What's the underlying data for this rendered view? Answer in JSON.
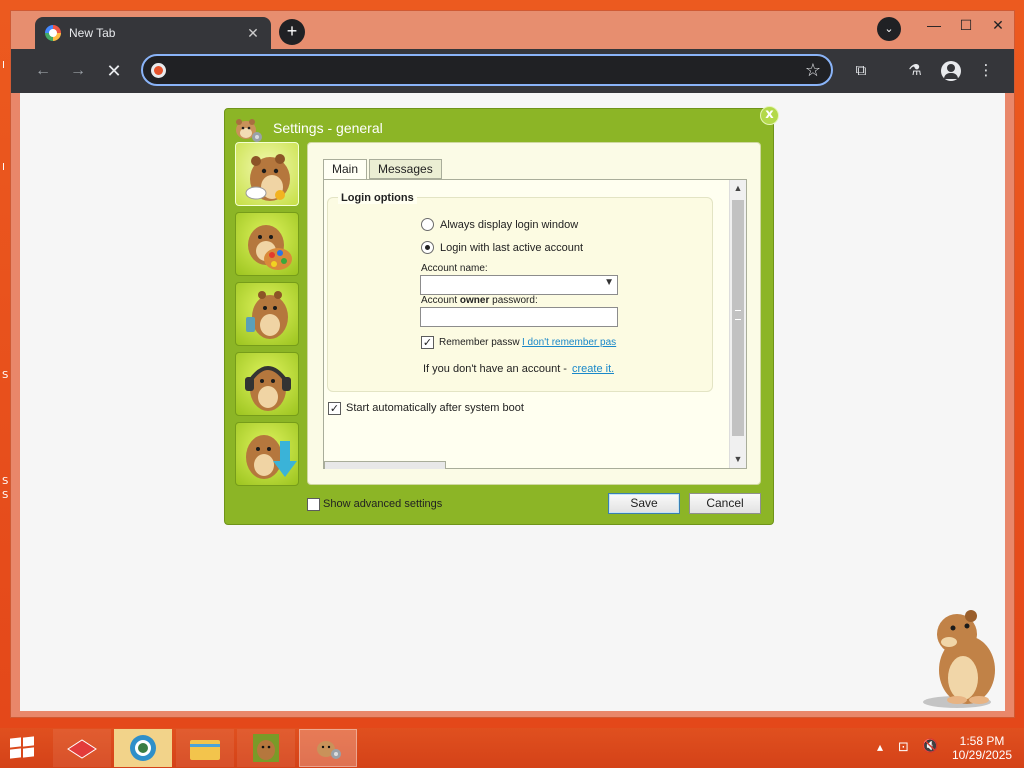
{
  "browser": {
    "tab": {
      "title": "New Tab",
      "close_glyph": "✕"
    },
    "new_tab_glyph": "+",
    "tab_search_glyph": "⌄",
    "window_controls": {
      "minimize": "—",
      "maximize": "☐",
      "close": "✕"
    },
    "nav": {
      "back": "←",
      "forward": "→",
      "stop": "✕"
    },
    "omnibox": {
      "value": "",
      "placeholder": ""
    },
    "toolbar_icons": [
      "star-icon",
      "extensions-icon",
      "labs-icon",
      "profile-icon",
      "menu-icon"
    ],
    "icon_glyphs": {
      "star": "☆",
      "extensions": "⧉",
      "labs": "⚗",
      "menu": "⋮"
    },
    "accent": "#8ab4f8"
  },
  "dialog": {
    "title": "Settings - general",
    "close_glyph": "x",
    "accent": "#8cb526",
    "side_buttons": [
      {
        "name": "general",
        "selected": true
      },
      {
        "name": "appearance",
        "selected": false
      },
      {
        "name": "phone",
        "selected": false
      },
      {
        "name": "sound",
        "selected": false
      },
      {
        "name": "download",
        "selected": false
      }
    ],
    "tabs": [
      {
        "label": "Main",
        "active": true
      },
      {
        "label": "Messages",
        "active": false
      }
    ],
    "login_options": {
      "legend": "Login options",
      "radio_always": {
        "label": "Always display login window",
        "checked": false
      },
      "radio_last": {
        "label": "Login with last active account",
        "checked": true
      },
      "account_name": {
        "label": "Account name:",
        "value": ""
      },
      "password": {
        "label_pre": "Account ",
        "label_bold": "owner",
        "label_post": " password:",
        "value": ""
      },
      "remember": {
        "label": "Remember passw",
        "checked": true,
        "check_glyph": "✓"
      },
      "forgot_link": "I don't remember pas",
      "no_account_text": "If you don't have an account - ",
      "create_link": "create it."
    },
    "autostart": {
      "label": "Start automatically after system boot",
      "checked": true,
      "check_glyph": "✓"
    },
    "show_advanced": {
      "label": "Show advanced settings",
      "checked": false
    },
    "buttons": {
      "save": "Save",
      "cancel": "Cancel"
    },
    "scroll_glyphs": {
      "up": "▲",
      "down": "▼"
    }
  },
  "desktop": {
    "edge_letters": [
      "I",
      "I",
      "S",
      "S",
      "S"
    ]
  },
  "taskbar": {
    "clock_time": "1:58 PM",
    "clock_date": "10/29/2025",
    "tray_glyphs": {
      "chevron": "▴",
      "network": "⊡",
      "volume": "🔇"
    }
  }
}
